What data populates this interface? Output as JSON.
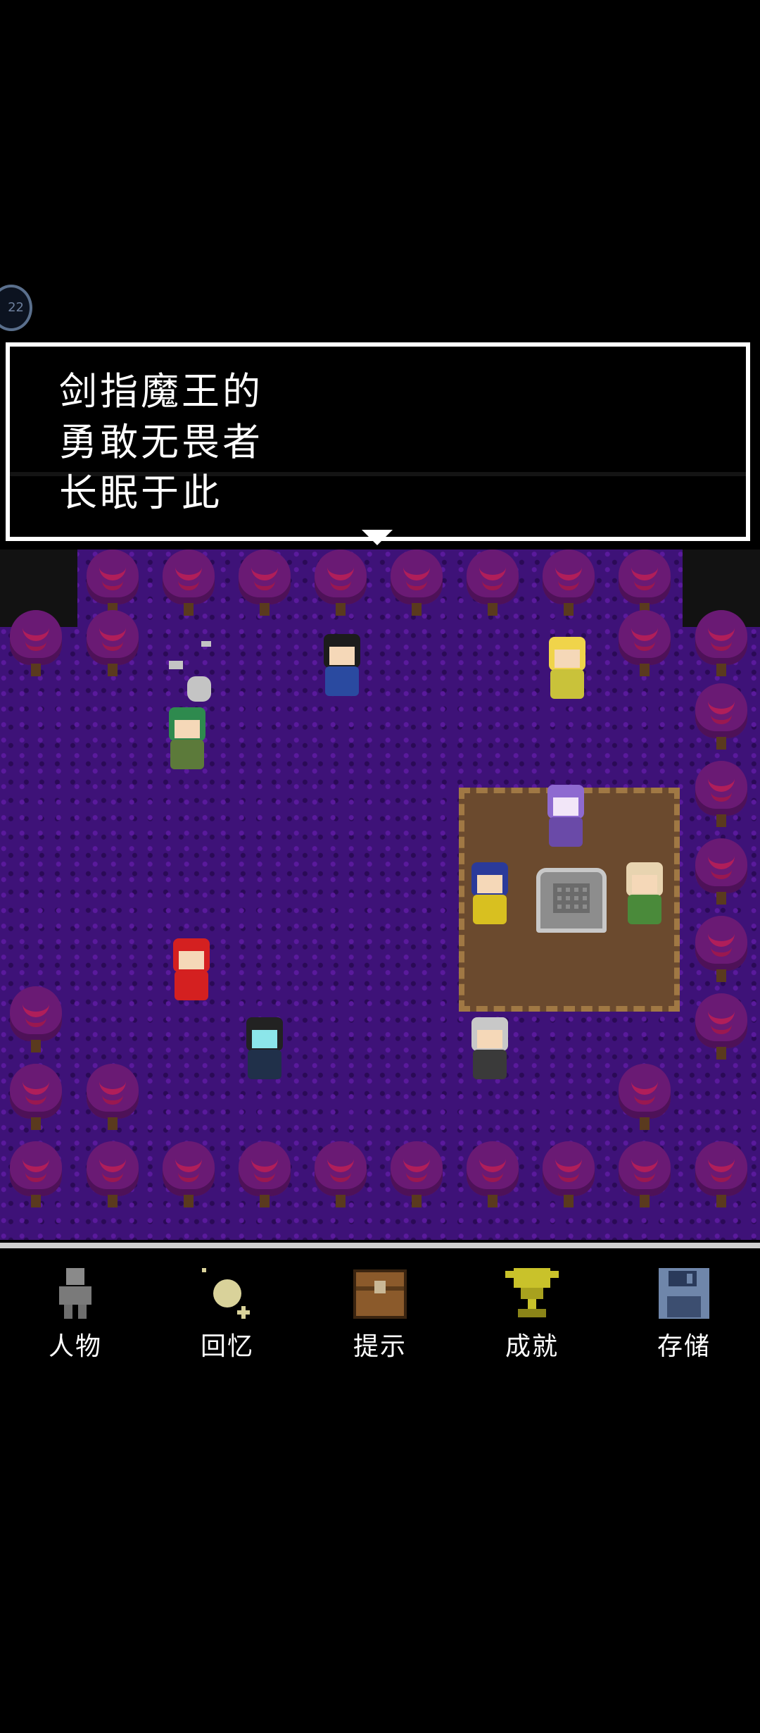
{
  "side_bubble": {
    "label": "22"
  },
  "dialog": {
    "lines": [
      "剑指魔王的",
      "勇敢无畏者",
      "长眠于此"
    ]
  },
  "menu": {
    "items": [
      {
        "id": "characters",
        "label": "人物",
        "icon": "person-icon",
        "color": "#8a8a8a"
      },
      {
        "id": "memories",
        "label": "回忆",
        "icon": "sparkle-icon",
        "color": "#d9d29a"
      },
      {
        "id": "hints",
        "label": "提示",
        "icon": "treasure-chest-icon",
        "color": "#8b5a2b"
      },
      {
        "id": "achievements",
        "label": "成就",
        "icon": "trophy-icon",
        "color": "#c9c22a"
      },
      {
        "id": "save",
        "label": "存储",
        "icon": "floppy-disk-icon",
        "color": "#6f86aa"
      }
    ]
  },
  "colors": {
    "field": "#3e1278",
    "dialog_border": "#ffffff",
    "bar_divider": "#cfcfcf"
  }
}
